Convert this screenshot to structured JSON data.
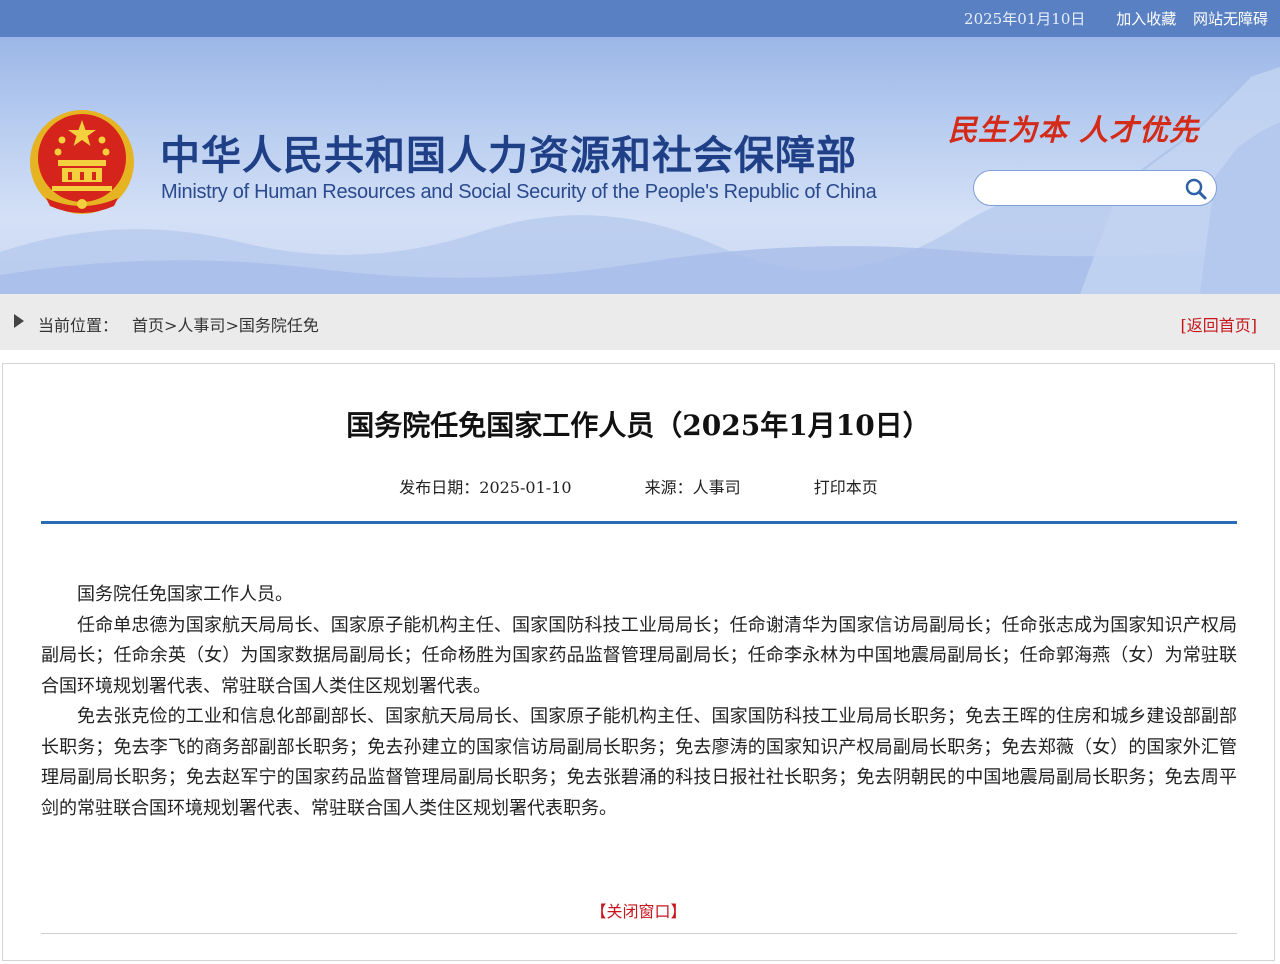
{
  "topbar": {
    "date": "2025年01月10日",
    "favorite_label": "加入收藏",
    "accessibility_label": "网站无障碍"
  },
  "banner": {
    "title_cn": "中华人民共和国人力资源和社会保障部",
    "title_en": "Ministry of Human Resources and Social Security of the People's Republic of China",
    "slogan": "民生为本 人才优先",
    "search_placeholder": ""
  },
  "breadcrumb": {
    "label": "当前位置：",
    "items": [
      "首页",
      "人事司",
      "国务院任免"
    ],
    "separator": ">",
    "back_home": "[返回首页]"
  },
  "article": {
    "title": "国务院任免国家工作人员（2025年1月10日）",
    "publish_label": "发布日期：",
    "publish_date": "2025-01-10",
    "source_label": "来源：",
    "source": "人事司",
    "print_label": "打印本页",
    "paragraphs": [
      "国务院任免国家工作人员。",
      "任命单忠德为国家航天局局长、国家原子能机构主任、国家国防科技工业局局长；任命谢清华为国家信访局副局长；任命张志成为国家知识产权局副局长；任命余英（女）为国家数据局副局长；任命杨胜为国家药品监督管理局副局长；任命李永林为中国地震局副局长；任命郭海燕（女）为常驻联合国环境规划署代表、常驻联合国人类住区规划署代表。",
      "免去张克俭的工业和信息化部副部长、国家航天局局长、国家原子能机构主任、国家国防科技工业局局长职务；免去王晖的住房和城乡建设部副部长职务；免去李飞的商务部副部长职务；免去孙建立的国家信访局副局长职务；免去廖涛的国家知识产权局副局长职务；免去郑薇（女）的国家外汇管理局副局长职务；免去赵军宁的国家药品监督管理局副局长职务；免去张碧涌的科技日报社社长职务；免去阴朝民的中国地震局副局长职务；免去周平剑的常驻联合国环境规划署代表、常驻联合国人类住区规划署代表职务。"
    ],
    "close_label": "【关闭窗口】"
  },
  "colors": {
    "topbar": "#5a80c4",
    "title_blue": "#1f3f86",
    "accent_red": "#c4161c",
    "rule_blue": "#2a6bb5"
  }
}
